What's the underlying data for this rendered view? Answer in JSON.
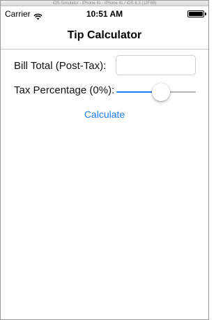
{
  "simulator": {
    "title": "iOS Simulator - iPhone 4s - iPhone 4s / iOS 8.3 (12F69)"
  },
  "statusbar": {
    "carrier": "Carrier",
    "time": "10:51 AM",
    "battery_level": 1.0
  },
  "navbar": {
    "title": "Tip Calculator"
  },
  "form": {
    "bill_label": "Bill Total (Post-Tax):",
    "bill_value": "",
    "tax_label": "Tax Percentage (0%):",
    "tax_slider_value": 0.58,
    "calculate_label": "Calculate"
  },
  "colors": {
    "accent": "#1a7cf2",
    "track": "#b5b5b5",
    "separator": "#c8c7cc"
  },
  "icons": {
    "wifi": "wifi-icon",
    "battery": "battery-icon"
  }
}
